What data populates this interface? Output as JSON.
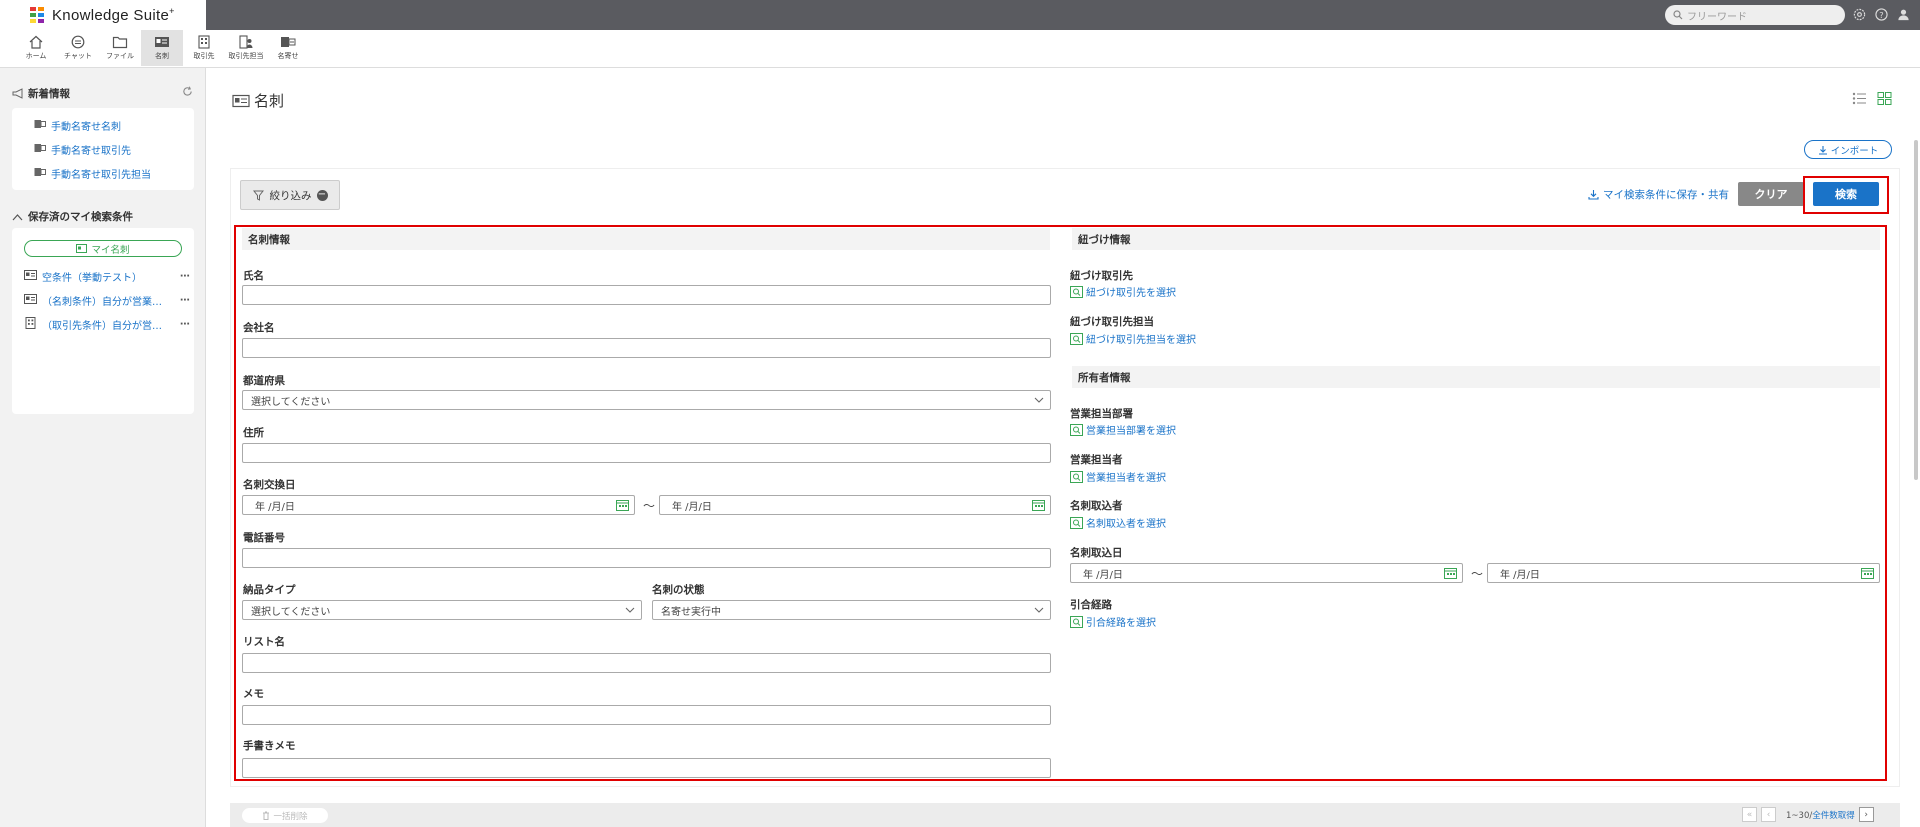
{
  "app": {
    "title": "Knowledge Suite",
    "title_sup": "+",
    "logo_colors": [
      "#e53935",
      "#fb8c00",
      "#43a047",
      "#1e88e5",
      "#fdd835",
      "#8e24aa"
    ]
  },
  "header": {
    "search_placeholder": "フリーワード",
    "icons": [
      "gear-icon",
      "help-icon",
      "user-icon"
    ]
  },
  "nav": {
    "items": [
      {
        "label": "ホーム",
        "icon": "home-icon"
      },
      {
        "label": "チャット",
        "icon": "chat-icon"
      },
      {
        "label": "ファイル",
        "icon": "folder-icon"
      },
      {
        "label": "名刺",
        "icon": "card-icon",
        "active": true
      },
      {
        "label": "取引先",
        "icon": "building-icon"
      },
      {
        "label": "取引先担当",
        "icon": "contact-icon"
      },
      {
        "label": "名寄せ",
        "icon": "merge-icon"
      }
    ]
  },
  "sidebar": {
    "news_title": "新着情報",
    "news_links": [
      "手動名寄せ名刺",
      "手動名寄せ取引先",
      "手動名寄せ取引先担当"
    ],
    "saved_title": "保存済のマイ検索条件",
    "my_card_button": "マイ名刺",
    "saved_items": [
      "空条件（挙動テスト）",
      "（名刺条件）自分が営業…",
      "（取引先条件）自分が営…"
    ]
  },
  "main": {
    "page_title": "名刺",
    "import_label": "インポート",
    "filter_label": "絞り込み",
    "save_search_label": "マイ検索条件に保存・共有",
    "clear_label": "クリア",
    "search_label": "検索"
  },
  "form": {
    "card_section": "名刺情報",
    "name_label": "氏名",
    "company_label": "会社名",
    "prefecture_label": "都道府県",
    "prefecture_value": "選択してください",
    "address_label": "住所",
    "exchange_date_label": "名刺交換日",
    "date_placeholder": "年 /月/日",
    "tilde": "～",
    "phone_label": "電話番号",
    "delivery_label": "納品タイプ",
    "delivery_value": "選択してください",
    "status_label": "名刺の状態",
    "status_value": "名寄せ実行中",
    "list_label": "リスト名",
    "memo_label": "メモ",
    "handwritten_label": "手書きメモ",
    "link_section": "紐づけ情報",
    "linked_company_label": "紐づけ取引先",
    "linked_company_link": "紐づけ取引先を選択",
    "linked_contact_label": "紐づけ取引先担当",
    "linked_contact_link": "紐づけ取引先担当を選択",
    "owner_section": "所有者情報",
    "sales_dept_label": "営業担当部署",
    "sales_dept_link": "営業担当部署を選択",
    "sales_person_label": "営業担当者",
    "sales_person_link": "営業担当者を選択",
    "importer_label": "名刺取込者",
    "importer_link": "名刺取込者を選択",
    "import_date_label": "名刺取込日",
    "source_label": "引合経路",
    "source_link": "引合経路を選択"
  },
  "footer": {
    "bulk_delete": "一括削除",
    "count_prefix": "1~30/",
    "count_link": "全件数取得"
  }
}
